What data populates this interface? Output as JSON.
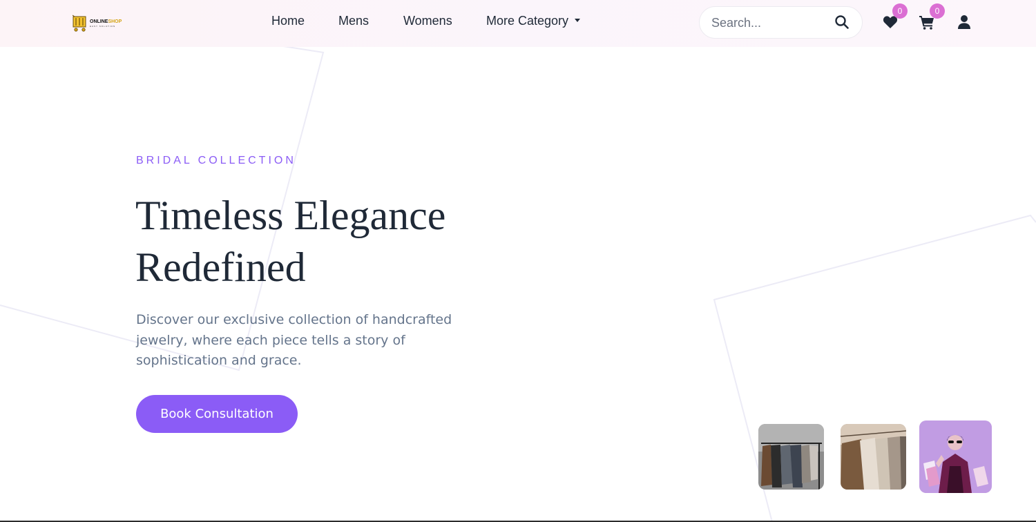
{
  "brand": {
    "logo_line1_a": "ONLINE",
    "logo_line1_b": "SHOP",
    "logo_line2": "EASY SOLUTION"
  },
  "nav": {
    "items": [
      {
        "label": "Home"
      },
      {
        "label": "Mens"
      },
      {
        "label": "Womens"
      },
      {
        "label": "More Category"
      }
    ]
  },
  "search": {
    "placeholder": "Search...",
    "value": ""
  },
  "wishlist": {
    "count": "0"
  },
  "cart": {
    "count": "0"
  },
  "hero": {
    "eyebrow": "BRIDAL COLLECTION",
    "headline_line1": "Timeless Elegance",
    "headline_line2": "Redefined",
    "description": "Discover our exclusive collection of handcrafted jewelry, where each piece tells a story of sophistication and grace.",
    "cta_label": "Book Consultation"
  },
  "colors": {
    "accent": "#8b5cf6",
    "badge": "#db6fd3",
    "heading": "#1f2937",
    "body_text": "#64748b"
  },
  "icons": {
    "search": "search-icon",
    "wishlist": "heart-icon",
    "cart": "shopping-cart-icon",
    "account": "user-icon",
    "dropdown": "caret-down-icon"
  }
}
